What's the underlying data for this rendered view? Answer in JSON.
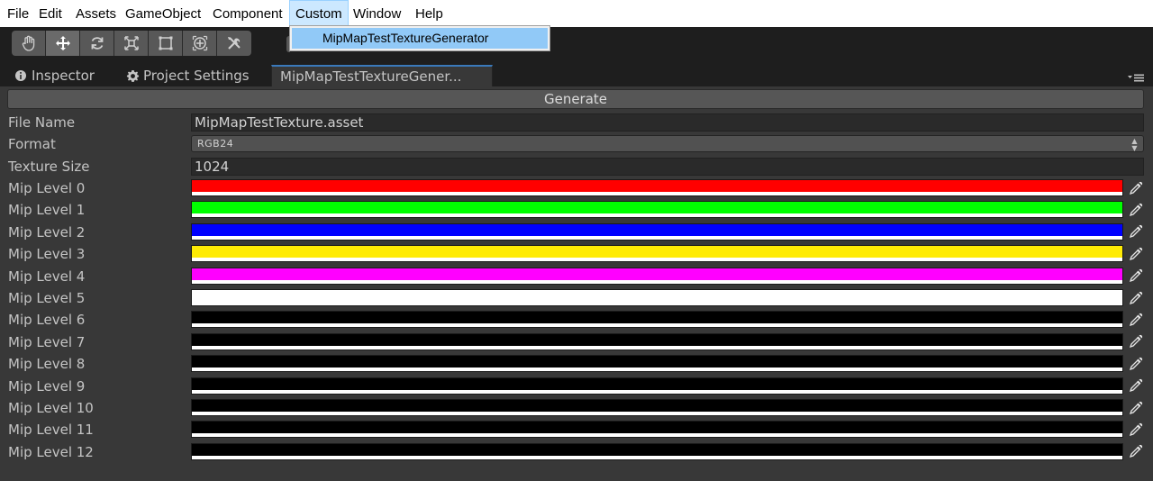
{
  "menubar": {
    "items": [
      "File",
      "Edit",
      "Assets",
      "GameObject",
      "Component",
      "Custom",
      "Window",
      "Help"
    ],
    "active": "Custom"
  },
  "dropdown": {
    "items": [
      "MipMapTestTextureGenerator"
    ]
  },
  "toolbar": {
    "tools": [
      "hand-tool",
      "move-tool",
      "rotate-tool",
      "scale-tool",
      "rect-tool",
      "transform-tool",
      "custom-tool"
    ],
    "active_tool": "move-tool"
  },
  "tabs": [
    {
      "label": "Inspector",
      "icon": "info-icon"
    },
    {
      "label": "Project Settings",
      "icon": "gear-icon"
    },
    {
      "label": "MipMapTestTextureGener...",
      "icon": null,
      "active": true
    }
  ],
  "generate_label": "Generate",
  "fields": {
    "file_name": {
      "label": "File Name",
      "value": "MipMapTestTexture.asset"
    },
    "format": {
      "label": "Format",
      "value": "RGB24"
    },
    "texture_size": {
      "label": "Texture Size",
      "value": "1024"
    }
  },
  "mip_levels": [
    {
      "label": "Mip Level 0",
      "color": "#ff0000"
    },
    {
      "label": "Mip Level 1",
      "color": "#00ff00"
    },
    {
      "label": "Mip Level 2",
      "color": "#0000ff"
    },
    {
      "label": "Mip Level 3",
      "color": "#ffeb04"
    },
    {
      "label": "Mip Level 4",
      "color": "#ff00ff"
    },
    {
      "label": "Mip Level 5",
      "color": "#ffffff"
    },
    {
      "label": "Mip Level 6",
      "color": "#000000"
    },
    {
      "label": "Mip Level 7",
      "color": "#000000"
    },
    {
      "label": "Mip Level 8",
      "color": "#000000"
    },
    {
      "label": "Mip Level 9",
      "color": "#000000"
    },
    {
      "label": "Mip Level 10",
      "color": "#000000"
    },
    {
      "label": "Mip Level 11",
      "color": "#000000"
    },
    {
      "label": "Mip Level 12",
      "color": "#000000"
    }
  ]
}
